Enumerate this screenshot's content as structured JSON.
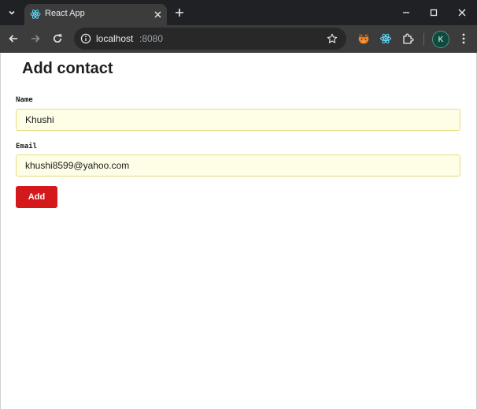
{
  "browser": {
    "tab": {
      "title": "React App",
      "favicon_icon": "react-icon"
    },
    "address_bar": {
      "host": "localhost",
      "port": ":8080",
      "info_icon": "info-icon"
    },
    "extensions": [
      "metamask-fox-icon",
      "react-devtools-icon",
      "puzzle-extensions-icon"
    ],
    "profile_initial": "K",
    "colors": {
      "tabstrip": "#202124",
      "toolbar": "#3c3c3c",
      "profile_avatar": "#0d4a3f"
    }
  },
  "page": {
    "title": "Add contact",
    "fields": [
      {
        "label": "Name",
        "value": "Khushi"
      },
      {
        "label": "Email",
        "value": "khushi8599@yahoo.com"
      }
    ],
    "submit_label": "Add",
    "colors": {
      "button": "#d3191c",
      "input_background": "#fefee7",
      "input_border": "#e4dc84"
    }
  }
}
